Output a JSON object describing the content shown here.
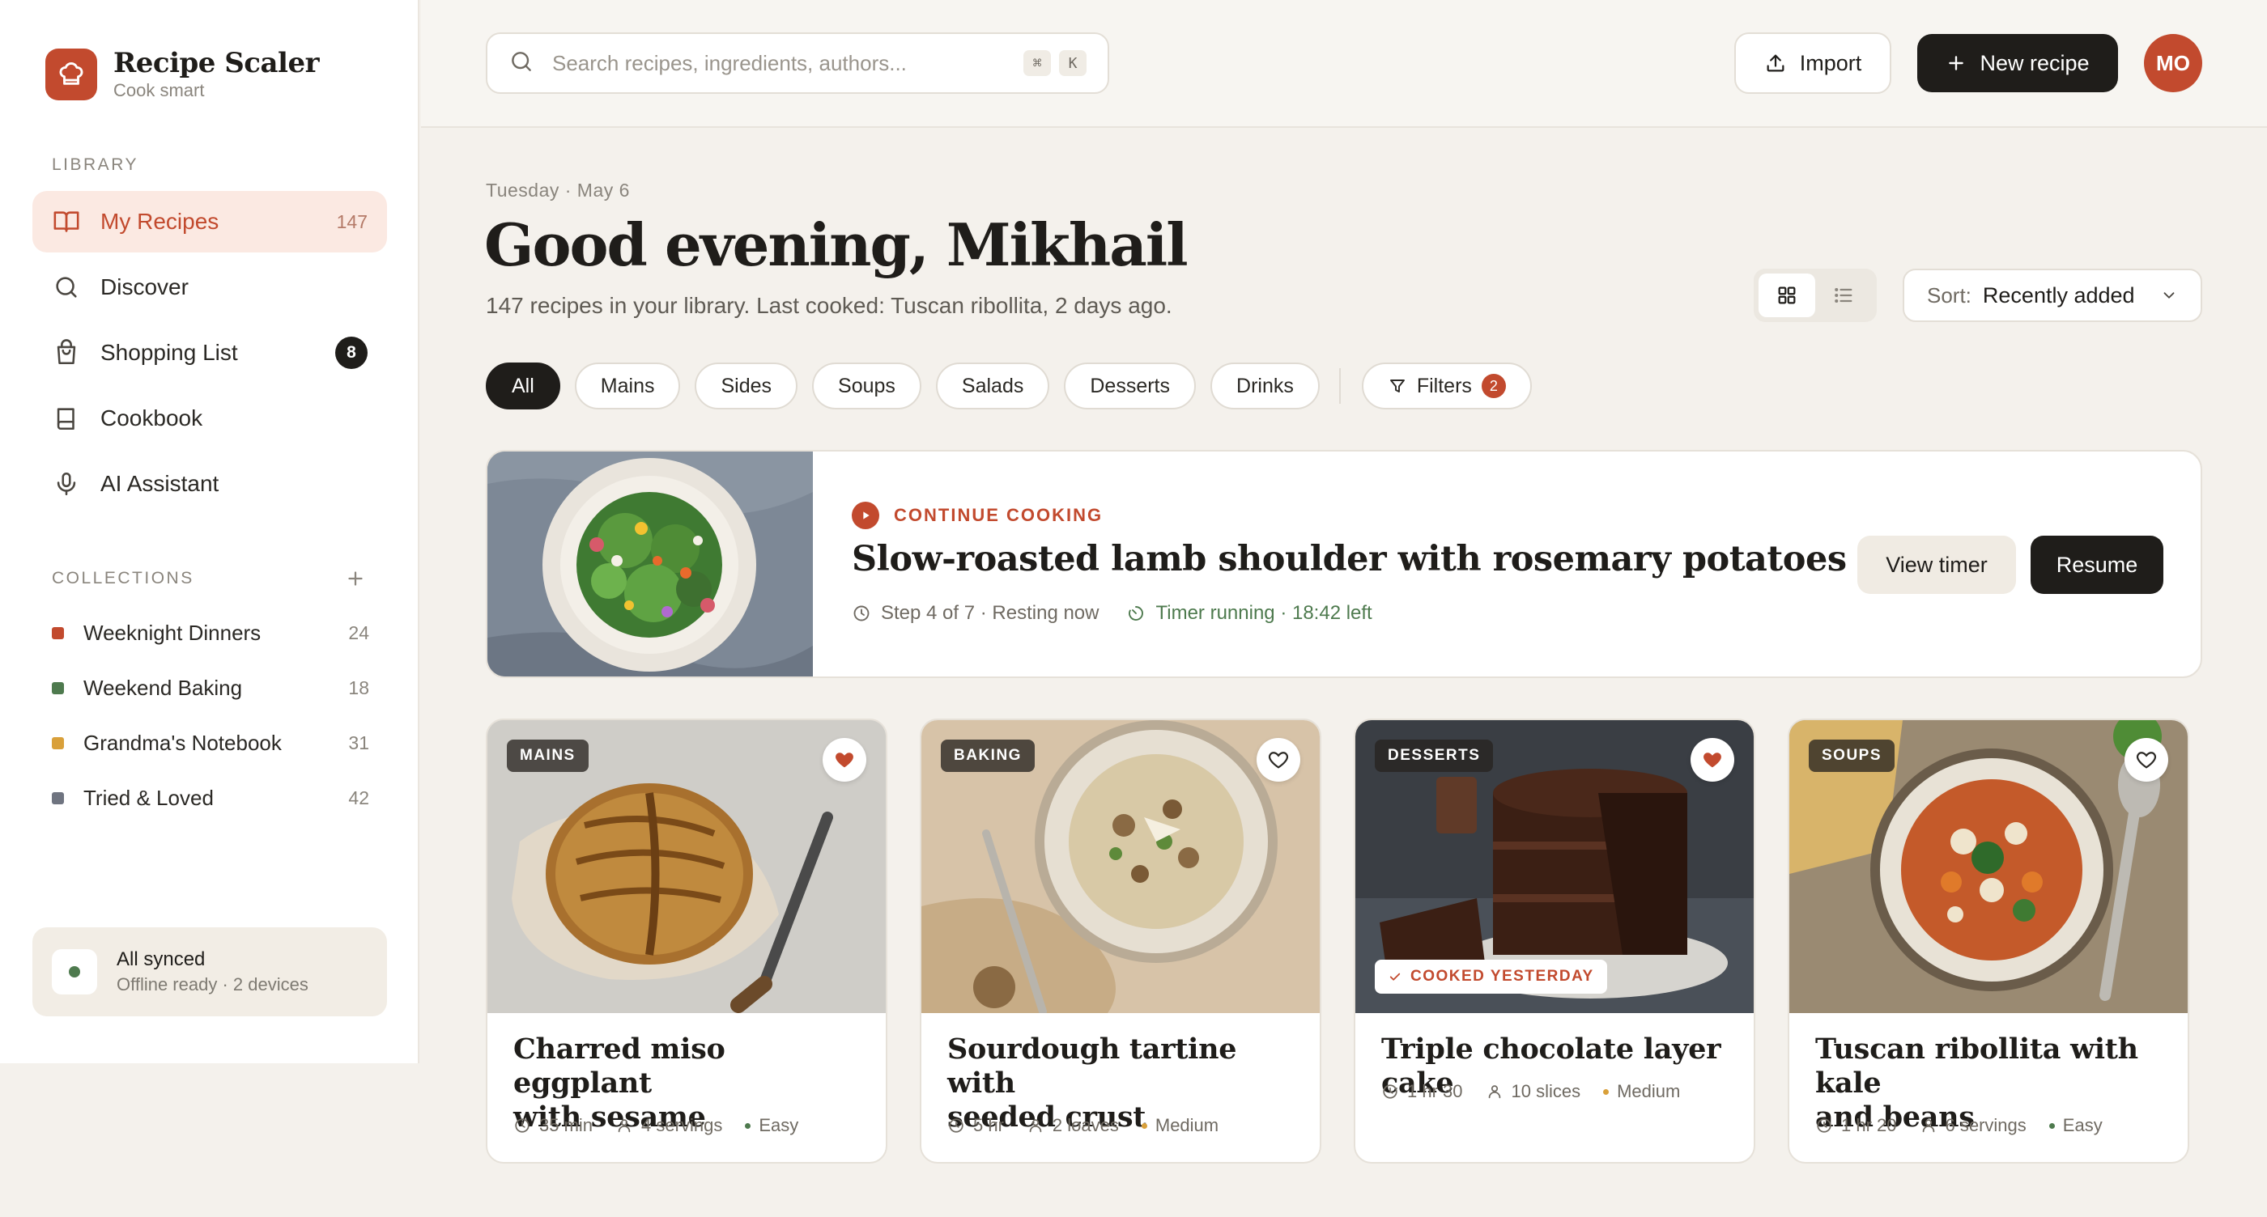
{
  "app": {
    "name": "Recipe Scaler",
    "tagline": "Cook smart"
  },
  "sidebar": {
    "library_label": "LIBRARY",
    "nav": [
      {
        "label": "My Recipes",
        "count": "147",
        "icon": "book-open-icon",
        "active": true
      },
      {
        "label": "Discover",
        "icon": "search-icon"
      },
      {
        "label": "Shopping List",
        "badge": "8",
        "icon": "shopping-bag-icon"
      },
      {
        "label": "Cookbook",
        "icon": "book-icon"
      },
      {
        "label": "AI Assistant",
        "icon": "microphone-icon"
      }
    ],
    "collections_label": "COLLECTIONS",
    "collections": [
      {
        "label": "Weeknight Dinners",
        "count": "24",
        "color": "#c24a2e"
      },
      {
        "label": "Weekend Baking",
        "count": "18",
        "color": "#4e7a4e"
      },
      {
        "label": "Grandma's Notebook",
        "count": "31",
        "color": "#d9a03a"
      },
      {
        "label": "Tried & Loved",
        "count": "42",
        "color": "#6f7480"
      }
    ],
    "sync": {
      "title": "All synced",
      "subtitle": "Offline ready · 2 devices"
    }
  },
  "topbar": {
    "search_placeholder": "Search recipes, ingredients, authors...",
    "shortcut": [
      "⌘",
      "K"
    ],
    "import_label": "Import",
    "new_label": "New recipe",
    "avatar_initials": "MO"
  },
  "main": {
    "date": "Tuesday · May 6",
    "greeting": "Good evening, Mikhail",
    "subline": "147 recipes in your library. Last cooked: Tuscan ribollita, 2 days ago.",
    "sort_label": "Sort:",
    "sort_value": "Recently added",
    "view_mode": "grid",
    "chips": [
      "All",
      "Mains",
      "Sides",
      "Soups",
      "Salads",
      "Desserts",
      "Drinks"
    ],
    "active_chip": "All",
    "filters_label": "Filters",
    "filters_count": "2",
    "continue": {
      "kicker": "CONTINUE COOKING",
      "title": "Slow-roasted lamb shoulder with rosemary potatoes",
      "step": "Step 4 of 7 · Resting now",
      "timer": "Timer running · 18:42 left",
      "view_timer_label": "View timer",
      "resume_label": "Resume"
    },
    "cards": [
      {
        "tag": "MAINS",
        "favorite": true,
        "title_line1": "Charred miso eggplant",
        "title_line2": "with sesame",
        "time": "35 min",
        "yield": "4 servings",
        "difficulty": "Easy",
        "difficulty_color": "#4e7a4e"
      },
      {
        "tag": "BAKING",
        "favorite": false,
        "title_line1": "Sourdough tartine with",
        "title_line2": "seeded crust",
        "time": "5 hr",
        "yield": "2 loaves",
        "difficulty": "Medium",
        "difficulty_color": "#d9a03a"
      },
      {
        "tag": "DESSERTS",
        "favorite": true,
        "title_line1": "Triple chocolate layer cake",
        "title_line2": "",
        "time": "1 hr 30",
        "yield": "10 slices",
        "difficulty": "Medium",
        "difficulty_color": "#d9a03a",
        "cooked_badge": "COOKED YESTERDAY"
      },
      {
        "tag": "SOUPS",
        "favorite": false,
        "title_line1": "Tuscan ribollita with kale",
        "title_line2": "and beans",
        "time": "1 hr 20",
        "yield": "6 servings",
        "difficulty": "Easy",
        "difficulty_color": "#4e7a4e"
      }
    ]
  },
  "colors": {
    "accent": "#c24a2e",
    "ink": "#1f1d1a",
    "green": "#4e7a4e",
    "background": "#f4f1ec"
  }
}
